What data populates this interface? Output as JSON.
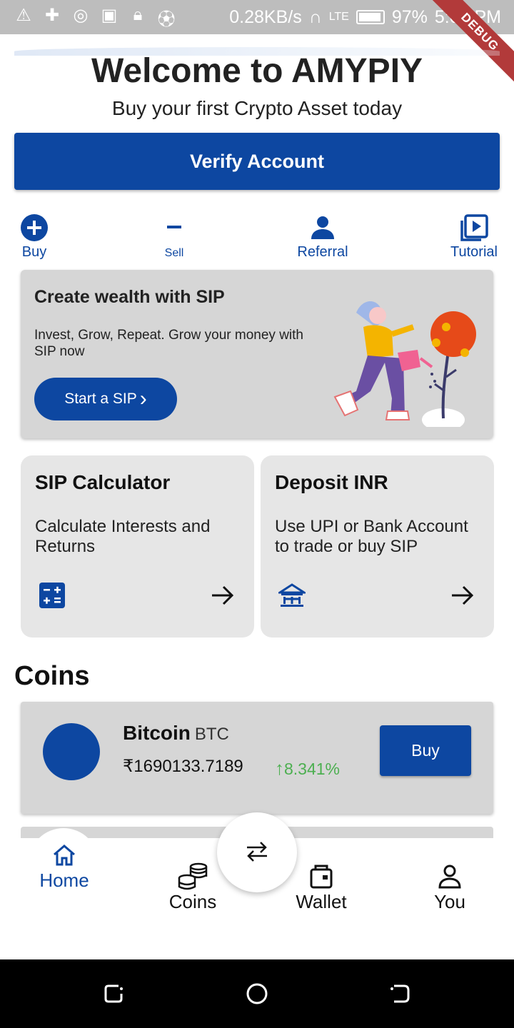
{
  "status_bar": {
    "network_speed": "0.28KB/s",
    "network_type": "LTE",
    "battery": "97%",
    "time": "5:05 PM",
    "debug_label": "DEBUG"
  },
  "header": {
    "title": "Welcome to AMYPIY",
    "subtitle": "Buy your first Crypto Asset today"
  },
  "verify": {
    "label": "Verify Account"
  },
  "quick_actions": [
    {
      "label": "Buy",
      "icon": "plus-circle-icon"
    },
    {
      "label": "Sell",
      "icon": "minus-icon"
    },
    {
      "label": "Referral",
      "icon": "person-icon"
    },
    {
      "label": "Tutorial",
      "icon": "video-library-icon"
    }
  ],
  "sip_banner": {
    "title": "Create wealth with SIP",
    "text": "Invest, Grow, Repeat. Grow your money with SIP now",
    "button_label": "Start a SIP",
    "button_arrow": "›"
  },
  "cards": [
    {
      "title": "SIP Calculator",
      "text": "Calculate Interests and Returns",
      "icon": "calculator-icon"
    },
    {
      "title": "Deposit INR",
      "text": "Use UPI or Bank Account to trade or buy SIP",
      "icon": "bank-icon"
    }
  ],
  "coins": {
    "heading": "Coins",
    "items": [
      {
        "name": "Bitcoin",
        "symbol": "BTC",
        "price": "₹1690133.7189",
        "change": "8.341%",
        "change_arrow": "↑",
        "buy_label": "Buy"
      }
    ]
  },
  "bottom_nav": {
    "items": [
      {
        "label": "Home",
        "icon": "home-icon",
        "active": true
      },
      {
        "label": "Coins",
        "icon": "coins-icon",
        "active": false
      },
      {
        "label": "Wallet",
        "icon": "wallet-icon",
        "active": false
      },
      {
        "label": "You",
        "icon": "profile-icon",
        "active": false
      }
    ],
    "fab_icon": "swap-arrows-icon"
  },
  "colors": {
    "primary": "#0d47a1",
    "positive": "#4caf50",
    "card_bg": "#d6d6d6",
    "status_bar": "#bdbdbd"
  }
}
